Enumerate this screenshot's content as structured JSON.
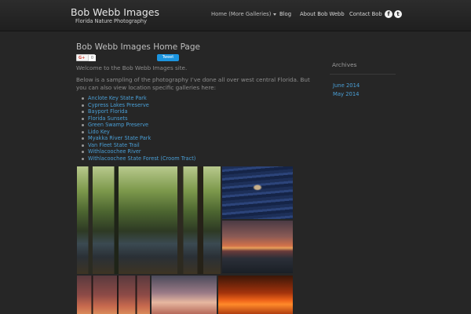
{
  "header": {
    "site_title": "Bob Webb Images",
    "tagline": "Florida Nature Photography",
    "nav": {
      "home": "Home (More Galleries)",
      "blog": "Blog",
      "about": "About Bob Webb",
      "contact": "Contact Bob"
    },
    "social": {
      "facebook": "f",
      "twitter": "t"
    }
  },
  "main": {
    "title": "Bob Webb Images Home Page",
    "share": {
      "gplus_label": "G+",
      "gplus_count": "0",
      "tweet_label": "Tweet"
    },
    "welcome": "Welcome to the Bob Webb Images site.",
    "intro": "Below is a sampling of the photography I’ve done all over west central Florida. But you can also view location specific galleries here:",
    "galleries": [
      "Anclote Key State Park",
      "Cypress Lakes Preserve",
      "Bayport Florida",
      "Florida Sunsets",
      "Green Swamp Preserve",
      "Lido Key",
      "Myakka River State Park",
      "Van Fleet State Trail",
      "Withlacoochee River",
      "Withlacoochee State Forest (Croom Tract)"
    ]
  },
  "sidebar": {
    "archives_title": "Archives",
    "archives": [
      "June 2014",
      "May 2014"
    ]
  },
  "colors": {
    "background": "#262626",
    "header": "#232323",
    "link": "#4a9fd6",
    "text": "#8c8c8c"
  }
}
